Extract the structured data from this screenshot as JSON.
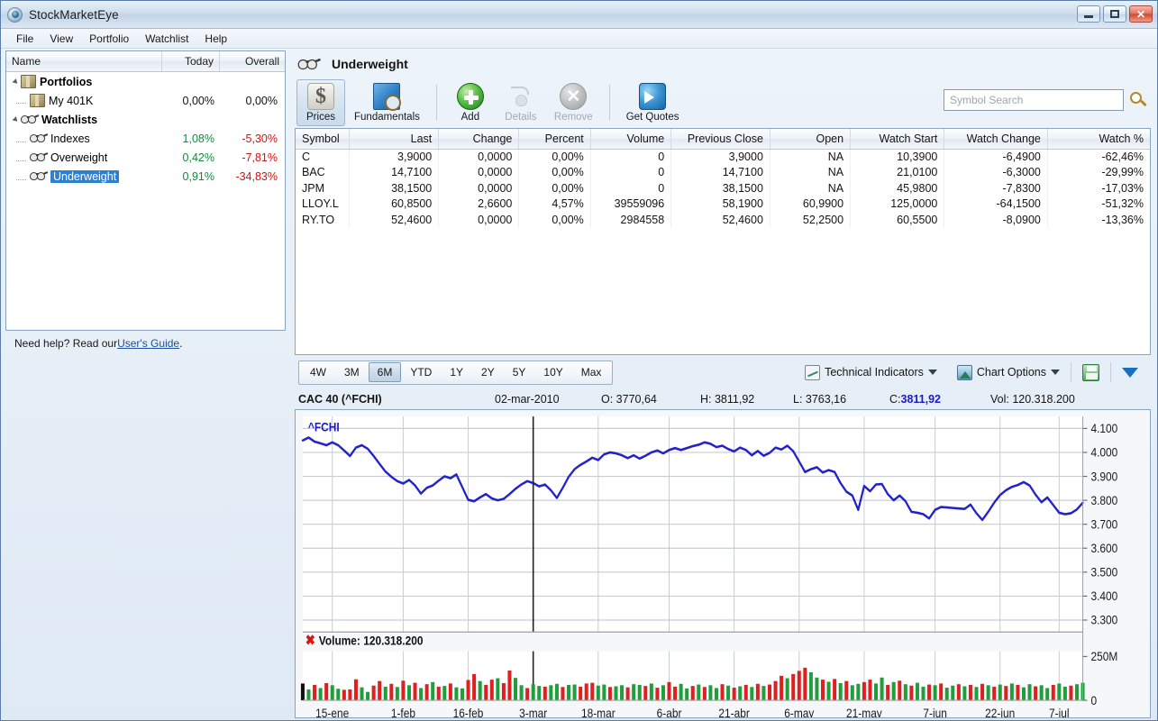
{
  "window": {
    "title": "StockMarketEye",
    "icon": "eye-icon",
    "minimize_label": "",
    "maximize_label": "",
    "close_label": "✕"
  },
  "menu": {
    "items": [
      "File",
      "View",
      "Portfolio",
      "Watchlist",
      "Help"
    ]
  },
  "sidebar": {
    "columns": [
      "Name",
      "Today",
      "Overall"
    ],
    "rows": [
      {
        "label": "Portfolios",
        "today": "",
        "overall": "",
        "level": 0,
        "bold": true,
        "icon": "package-icon",
        "expander": true,
        "selected": false
      },
      {
        "label": "My 401K",
        "today": "0,00%",
        "overall": "0,00%",
        "level": 1,
        "bold": false,
        "icon": "package-icon",
        "expander": false,
        "selected": false,
        "today_tone": "neutral",
        "overall_tone": "neutral"
      },
      {
        "label": "Watchlists",
        "today": "",
        "overall": "",
        "level": 0,
        "bold": true,
        "icon": "glasses-icon",
        "expander": true,
        "selected": false
      },
      {
        "label": "Indexes",
        "today": "1,08%",
        "overall": "-5,30%",
        "level": 1,
        "bold": false,
        "icon": "glasses-icon",
        "expander": false,
        "selected": false,
        "today_tone": "pos",
        "overall_tone": "neg"
      },
      {
        "label": "Overweight",
        "today": "0,42%",
        "overall": "-7,81%",
        "level": 1,
        "bold": false,
        "icon": "glasses-icon",
        "expander": false,
        "selected": false,
        "today_tone": "pos",
        "overall_tone": "neg"
      },
      {
        "label": "Underweight",
        "today": "0,91%",
        "overall": "-34,83%",
        "level": 1,
        "bold": false,
        "icon": "glasses-icon",
        "expander": false,
        "selected": true,
        "today_tone": "pos",
        "overall_tone": "neg"
      }
    ]
  },
  "statusbar": {
    "text_before": "Need help? Read our ",
    "link": "User's Guide",
    "text_after": "."
  },
  "watchlist": {
    "title": "Underweight",
    "icon": "glasses-icon"
  },
  "toolbar": {
    "buttons": [
      {
        "label": "Prices",
        "icon": "dollar-icon",
        "state": "active"
      },
      {
        "label": "Fundamentals",
        "icon": "book-magnifier-icon",
        "state": "normal"
      },
      {
        "label": "Add",
        "icon": "plus-circle-icon",
        "state": "normal"
      },
      {
        "label": "Details",
        "icon": "details-icon",
        "state": "disabled"
      },
      {
        "label": "Remove",
        "icon": "remove-circle-icon",
        "state": "disabled"
      },
      {
        "label": "Get Quotes",
        "icon": "refresh-quotes-icon",
        "state": "normal"
      }
    ]
  },
  "search": {
    "placeholder": "Symbol Search",
    "value": "",
    "icon": "magnifier-icon"
  },
  "quotes_table": {
    "columns": [
      "Symbol",
      "Last",
      "Change",
      "Percent",
      "Volume",
      "Previous Close",
      "Open",
      "Watch Start",
      "Watch Change",
      "Watch %"
    ],
    "rows": [
      {
        "symbol": "C",
        "last": "3,9000",
        "change": "0,0000",
        "percent": "0,00%",
        "volume": "0",
        "previous_close": "3,9000",
        "open": "NA",
        "watch_start": "10,3900",
        "watch_change": "-6,4900",
        "watch_pct": "-62,46%",
        "change_tone": "neutral",
        "watch_tone": "neg"
      },
      {
        "symbol": "BAC",
        "last": "14,7100",
        "change": "0,0000",
        "percent": "0,00%",
        "volume": "0",
        "previous_close": "14,7100",
        "open": "NA",
        "watch_start": "21,0100",
        "watch_change": "-6,3000",
        "watch_pct": "-29,99%",
        "change_tone": "neutral",
        "watch_tone": "neg"
      },
      {
        "symbol": "JPM",
        "last": "38,1500",
        "change": "0,0000",
        "percent": "0,00%",
        "volume": "0",
        "previous_close": "38,1500",
        "open": "NA",
        "watch_start": "45,9800",
        "watch_change": "-7,8300",
        "watch_pct": "-17,03%",
        "change_tone": "neutral",
        "watch_tone": "neg"
      },
      {
        "symbol": "LLOY.L",
        "last": "60,8500",
        "change": "2,6600",
        "percent": "4,57%",
        "volume": "39559096",
        "previous_close": "58,1900",
        "open": "60,9900",
        "watch_start": "125,0000",
        "watch_change": "-64,1500",
        "watch_pct": "-51,32%",
        "change_tone": "pos",
        "watch_tone": "neg"
      },
      {
        "symbol": "RY.TO",
        "last": "52,4600",
        "change": "0,0000",
        "percent": "0,00%",
        "volume": "2984558",
        "previous_close": "52,4600",
        "open": "52,2500",
        "watch_start": "60,5500",
        "watch_change": "-8,0900",
        "watch_pct": "-13,36%",
        "change_tone": "neutral",
        "watch_tone": "neg"
      }
    ]
  },
  "chart_toolbar": {
    "periods": [
      "4W",
      "3M",
      "6M",
      "YTD",
      "1Y",
      "2Y",
      "5Y",
      "10Y",
      "Max"
    ],
    "selected_period": "6M",
    "technical_indicators_label": "Technical Indicators",
    "chart_options_label": "Chart Options",
    "save_icon": "save-icon",
    "expand_icon": "chevron-down-icon"
  },
  "chart_header": {
    "name": "CAC 40 (^FCHI)",
    "date": "02-mar-2010",
    "open": "O: 3770,64",
    "high": "H: 3811,92",
    "low": "L: 3763,16",
    "close_label": "C:",
    "close_value": "3811,92",
    "volume": "Vol: 120.318.200"
  },
  "chart_data": {
    "type": "line",
    "title": "CAC 40 (^FCHI)",
    "series_label": "^FCHI",
    "volume_label": "Volume: 120.318.200",
    "ylabel": "",
    "xlabel": "",
    "ylim": [
      3250,
      4150
    ],
    "yticks": [
      4100,
      4000,
      3900,
      3800,
      3700,
      3600,
      3500,
      3400,
      3300
    ],
    "ytick_labels": [
      "4.100",
      "4.000",
      "3.900",
      "3.800",
      "3.700",
      "3.600",
      "3.500",
      "3.400",
      "3.300"
    ],
    "volume_ylim": [
      0,
      280
    ],
    "volume_yticks": [
      250,
      0
    ],
    "volume_ytick_labels": [
      "250M",
      "0"
    ],
    "grid": true,
    "legend_position": "top-left",
    "xtick_labels": [
      "15-ene",
      "1-feb",
      "16-feb",
      "3-mar",
      "18-mar",
      "6-abr",
      "21-abr",
      "6-may",
      "21-may",
      "7-jun",
      "22-jun",
      "7-jul"
    ],
    "xtick_indices": [
      5,
      17,
      28,
      39,
      50,
      62,
      73,
      84,
      95,
      107,
      118,
      128
    ],
    "cursor_index": 39,
    "cursor_date": "02-mar-2010",
    "values": [
      4050,
      4062,
      4045,
      4038,
      4030,
      4042,
      4030,
      4008,
      3985,
      4020,
      4030,
      4015,
      3985,
      3952,
      3920,
      3898,
      3880,
      3870,
      3885,
      3862,
      3828,
      3852,
      3862,
      3882,
      3900,
      3892,
      3908,
      3855,
      3802,
      3796,
      3812,
      3826,
      3808,
      3800,
      3806,
      3826,
      3848,
      3866,
      3880,
      3872,
      3858,
      3866,
      3842,
      3810,
      3852,
      3898,
      3930,
      3948,
      3962,
      3978,
      3968,
      3992,
      4000,
      3996,
      3988,
      3976,
      3988,
      3974,
      3986,
      4000,
      4008,
      3996,
      4010,
      4018,
      4010,
      4018,
      4026,
      4032,
      4042,
      4036,
      4022,
      4028,
      4014,
      4004,
      4020,
      4010,
      3988,
      4006,
      3986,
      3998,
      4020,
      4012,
      4028,
      4005,
      3962,
      3918,
      3930,
      3938,
      3916,
      3926,
      3918,
      3872,
      3836,
      3820,
      3760,
      3860,
      3838,
      3866,
      3868,
      3826,
      3800,
      3820,
      3796,
      3752,
      3748,
      3742,
      3724,
      3760,
      3772,
      3770,
      3768,
      3766,
      3764,
      3782,
      3746,
      3718,
      3752,
      3790,
      3822,
      3842,
      3856,
      3864,
      3876,
      3862,
      3824,
      3792,
      3812,
      3780,
      3748,
      3742,
      3746,
      3762,
      3790
    ],
    "volume": [
      96,
      62,
      88,
      70,
      98,
      86,
      66,
      60,
      62,
      120,
      74,
      48,
      84,
      110,
      78,
      94,
      76,
      112,
      86,
      100,
      70,
      92,
      104,
      78,
      82,
      96,
      74,
      68,
      116,
      150,
      110,
      88,
      118,
      126,
      98,
      170,
      128,
      86,
      70,
      92,
      82,
      78,
      86,
      94,
      76,
      88,
      90,
      78,
      96,
      100,
      84,
      90,
      76,
      80,
      86,
      74,
      92,
      88,
      82,
      96,
      72,
      86,
      104,
      78,
      94,
      68,
      82,
      90,
      76,
      86,
      70,
      92,
      84,
      72,
      80,
      88,
      76,
      94,
      82,
      90,
      110,
      140,
      126,
      150,
      168,
      186,
      160,
      130,
      118,
      106,
      122,
      98,
      110,
      86,
      94,
      104,
      118,
      96,
      130,
      88,
      104,
      112,
      92,
      84,
      100,
      78,
      90,
      86,
      96,
      72,
      84,
      92,
      80,
      88,
      76,
      94,
      86,
      78,
      90,
      82,
      96,
      88,
      74,
      92,
      80,
      86,
      70,
      88,
      96,
      78,
      84,
      92,
      100
    ],
    "volume_colors": [
      "d",
      "g",
      "r",
      "g",
      "r",
      "g",
      "g",
      "r",
      "r",
      "r",
      "g",
      "g",
      "r",
      "r",
      "g",
      "r",
      "g",
      "r",
      "g",
      "r",
      "g",
      "r",
      "g",
      "r",
      "g",
      "r",
      "g",
      "g",
      "r",
      "r",
      "g",
      "r",
      "r",
      "g",
      "r",
      "r",
      "g",
      "g",
      "r",
      "g",
      "g",
      "r",
      "g",
      "g",
      "r",
      "g",
      "g",
      "r",
      "r",
      "r",
      "g",
      "g",
      "r",
      "g",
      "g",
      "r",
      "g",
      "g",
      "r",
      "g",
      "r",
      "g",
      "r",
      "r",
      "g",
      "g",
      "r",
      "g",
      "r",
      "g",
      "g",
      "r",
      "g",
      "r",
      "g",
      "r",
      "g",
      "r",
      "g",
      "r",
      "r",
      "r",
      "g",
      "r",
      "r",
      "r",
      "g",
      "g",
      "r",
      "g",
      "r",
      "g",
      "r",
      "g",
      "g",
      "r",
      "r",
      "g",
      "g",
      "r",
      "g",
      "r",
      "g",
      "r",
      "g",
      "g",
      "r",
      "g",
      "r",
      "g",
      "g",
      "r",
      "g",
      "r",
      "g",
      "r",
      "g",
      "r",
      "g",
      "r",
      "g",
      "r",
      "g",
      "g",
      "r",
      "g",
      "g",
      "r",
      "g",
      "g",
      "r",
      "g",
      "g"
    ]
  },
  "colors": {
    "positive": "#128a3c",
    "negative": "#d51111",
    "line": "#2222cc",
    "volume_up": "#1f9f3a",
    "volume_down": "#e02020",
    "accent": "#2f7fd1"
  }
}
